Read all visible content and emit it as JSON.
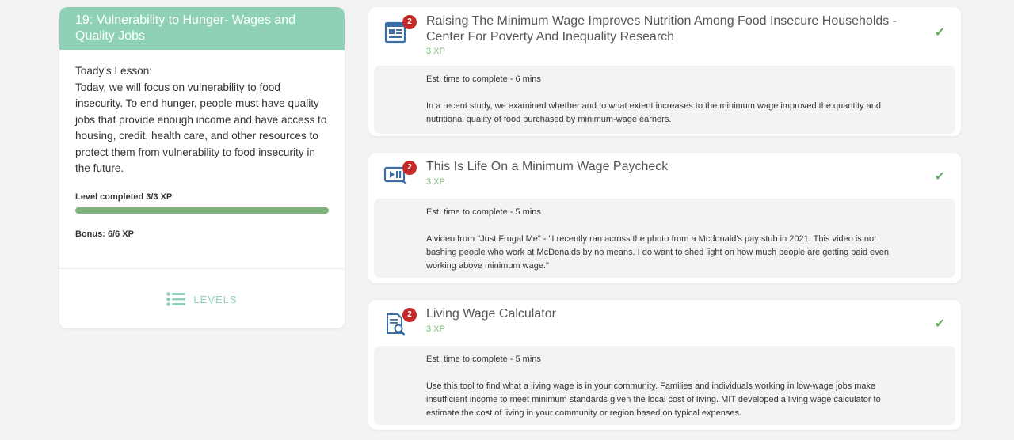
{
  "lesson": {
    "title": "19: Vulnerability to Hunger- Wages and Quality Jobs",
    "lesson_label": "Toady's Lesson:",
    "lesson_text": "Today, we will focus on vulnerability to food insecurity. To end hunger, people must have quality jobs that provide enough income and have access to housing, credit, health care, and other resources to protect them from vulnerability to food insecurity in the future.",
    "level_completed": "Level completed 3/3 XP",
    "progress_fraction": 1.0,
    "bonus": "Bonus: 6/6 XP",
    "levels_label": "LEVELS",
    "levels_icon": "list-icon"
  },
  "colors": {
    "header": "#8fd1b6",
    "progress": "#7db37b",
    "badge": "#c62828",
    "check": "#6db06a",
    "icon": "#3a6ea5"
  },
  "activities": [
    {
      "icon": "article-icon",
      "badge": "2",
      "title": "Raising The Minimum Wage Improves Nutrition Among Food Insecure Households - Center For Poverty And Inequality Research",
      "xp": "3 XP",
      "est": "Est. time to complete - 6 mins",
      "description": "In a recent study, we examined whether and to what extent increases to the minimum wage improved the quantity and nutritional quality of food purchased by minimum-wage earners.",
      "completed_icon": "check-icon"
    },
    {
      "icon": "video-icon",
      "badge": "2",
      "title": "This Is Life On a Minimum Wage Paycheck",
      "xp": "3 XP",
      "est": "Est. time to complete - 5 mins",
      "description": "A video from \"Just Frugal Me\" - \"I recently ran across the photo from a Mcdonald's pay stub in 2021. This video is not bashing people who work at McDonalds by no means. I do want to shed light on how much people are getting paid even working above minimum wage.\"",
      "completed_icon": "check-icon"
    },
    {
      "icon": "document-search-icon",
      "badge": "2",
      "title": "Living Wage Calculator",
      "xp": "3 XP",
      "est": "Est. time to complete - 5 mins",
      "description": "Use this tool to find what a living wage is in your community. Families and individuals working in low-wage jobs make insufficient income to meet minimum standards given the local cost of living. MIT developed a living wage calculator to estimate the cost of living in your community or region based on typical expenses.",
      "completed_icon": "check-icon"
    }
  ]
}
